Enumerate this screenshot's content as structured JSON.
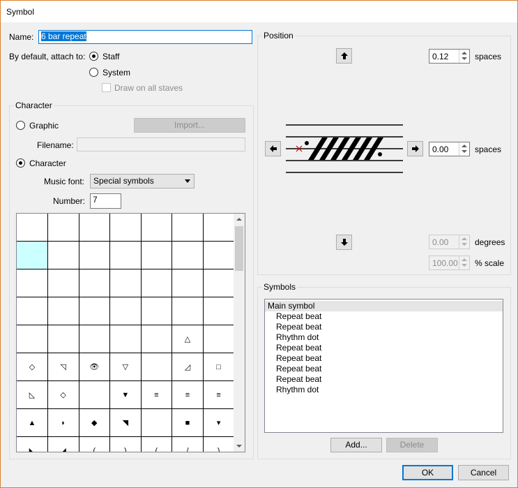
{
  "window": {
    "title": "Symbol"
  },
  "name": {
    "label": "Name:",
    "value": "6 bar repeat"
  },
  "attach": {
    "label": "By default, attach to:",
    "staff": "Staff",
    "system": "System",
    "draw_all": "Draw on all staves"
  },
  "character_group": {
    "title": "Character",
    "graphic": "Graphic",
    "import": "Import...",
    "filename_label": "Filename:",
    "filename_value": "",
    "character": "Character",
    "music_font_label": "Music font:",
    "music_font_value": "Special symbols",
    "number_label": "Number:",
    "number_value": "7"
  },
  "glyph_grid": {
    "rows": [
      [
        "",
        "",
        "",
        "",
        "",
        "",
        ""
      ],
      [
        "",
        "",
        "",
        "",
        "",
        "",
        ""
      ],
      [
        "",
        "",
        "",
        "",
        "",
        "",
        ""
      ],
      [
        "",
        "",
        "",
        "",
        "",
        "",
        ""
      ],
      [
        "",
        "",
        "",
        "",
        "",
        "△",
        ""
      ],
      [
        "◇",
        "◹",
        "👁",
        "▽",
        "",
        "◿",
        "□"
      ],
      [
        "◺",
        "◇",
        "",
        "▼",
        "≡",
        "≡",
        "≡"
      ],
      [
        "▲",
        "◗",
        "◆",
        "◥",
        "",
        "■",
        "▾"
      ],
      [
        "◣",
        "◢",
        "(",
        ")",
        "(",
        "/",
        ")"
      ]
    ],
    "selected": {
      "row": 1,
      "col": 0
    }
  },
  "position": {
    "title": "Position",
    "vertical_value": "0.12",
    "vertical_unit": "spaces",
    "horizontal_value": "0.00",
    "horizontal_unit": "spaces",
    "rotation_value": "0.00",
    "rotation_unit": "degrees",
    "scale_value": "100.00",
    "scale_unit": "% scale"
  },
  "symbols": {
    "title": "Symbols",
    "items": [
      "Main symbol",
      "Repeat beat",
      "Repeat beat",
      "Rhythm dot",
      "Repeat beat",
      "Repeat beat",
      "Repeat beat",
      "Repeat beat",
      "Rhythm dot"
    ],
    "add": "Add...",
    "delete": "Delete"
  },
  "footer": {
    "ok": "OK",
    "cancel": "Cancel"
  }
}
